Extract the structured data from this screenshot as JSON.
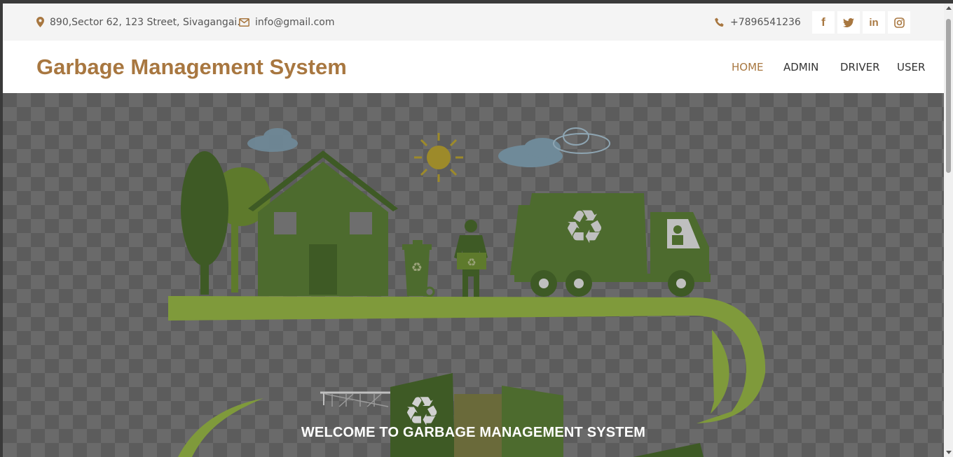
{
  "topbar": {
    "address": "890,Sector 62, 123 Street, Sivagangai.",
    "email": "info@gmail.com",
    "phone": "+7896541236",
    "icons": {
      "address": "map-marker-icon",
      "email": "envelope-icon",
      "phone": "phone-icon"
    },
    "social": [
      {
        "name": "facebook-icon",
        "glyph": "f"
      },
      {
        "name": "twitter-icon",
        "glyph": "🐦"
      },
      {
        "name": "linkedin-icon",
        "glyph": "in"
      },
      {
        "name": "instagram-icon",
        "glyph": "◎"
      }
    ]
  },
  "header": {
    "brand": "Garbage Management System",
    "nav": [
      {
        "label": "HOME",
        "active": true
      },
      {
        "label": "ADMIN",
        "active": false
      },
      {
        "label": "DRIVER",
        "active": false
      },
      {
        "label": "USER",
        "active": false
      }
    ]
  },
  "hero": {
    "title": "WELCOME TO GARBAGE MANAGEMENT SYSTEM"
  },
  "colors": {
    "accent": "#a87740",
    "topbar_bg": "#f4f4f4",
    "illustration_green": "#4d6b2e",
    "illustration_light_green": "#7f9a3b"
  }
}
